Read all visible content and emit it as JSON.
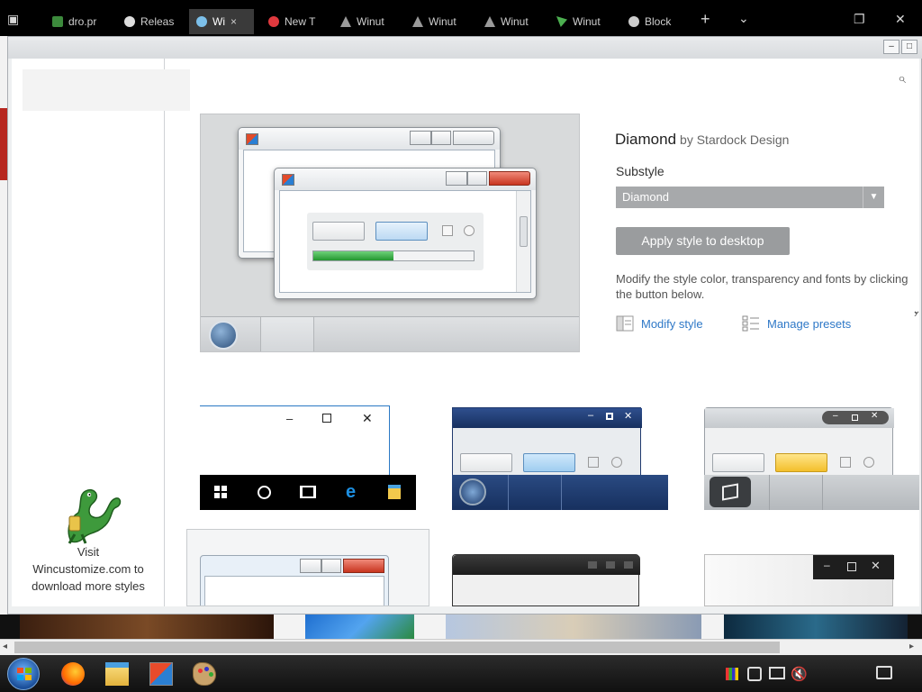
{
  "browser": {
    "tabs": [
      {
        "label": "dro.pr",
        "active": false,
        "icon_color": "#3c8a3c"
      },
      {
        "label": "Releas",
        "active": false,
        "icon_color": "#dddddd"
      },
      {
        "label": "Wi",
        "active": true,
        "icon_color": "#7cc0ea"
      },
      {
        "label": "New T",
        "active": false,
        "icon_color": "#e0393e"
      },
      {
        "label": "Winut",
        "active": false,
        "icon_color": "#9a9a9a"
      },
      {
        "label": "Winut",
        "active": false,
        "icon_color": "#9a9a9a"
      },
      {
        "label": "Winut",
        "active": false,
        "icon_color": "#9a9a9a"
      },
      {
        "label": "Winut",
        "active": false,
        "icon_color": "#4caf50"
      },
      {
        "label": "Block",
        "active": false,
        "icon_color": "#cccccc"
      }
    ],
    "tab_close": "×",
    "new_tab": "+",
    "tab_menu": "⌄",
    "restore": "❐",
    "close": "✕"
  },
  "window": {
    "min": "–",
    "max": "□",
    "close": "✕"
  },
  "search_icon": "⌕",
  "left_panel": {
    "visit_text": "Visit\nWincustomize.com to\ndownload more styles"
  },
  "style": {
    "name": "Diamond",
    "author": "by Stardock Design",
    "substyle_label": "Substyle",
    "substyle_value": "Diamond",
    "apply_label": "Apply style to desktop",
    "description": "Modify the style color, transparency and fonts by clicking the button below.",
    "modify_label": "Modify style",
    "presets_label": "Manage presets"
  },
  "colors": {
    "accent_link": "#2e78c7",
    "progress_green": "#2fa53c"
  },
  "preview": {
    "progress": 0.5
  }
}
